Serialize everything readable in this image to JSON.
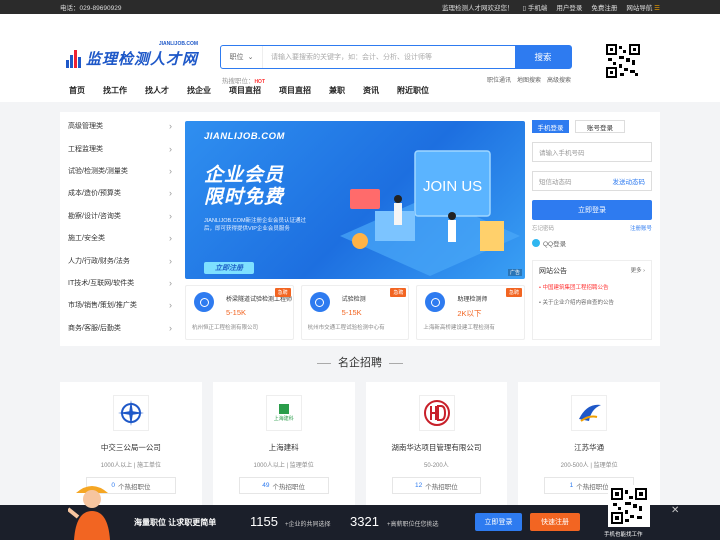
{
  "topbar": {
    "phone": "电话：029-89690929",
    "welcome": "监理检测人才网欢迎您！",
    "mobile": "手机端",
    "user_login": "用户登录",
    "free_register": "免费注册",
    "site_nav": "网站导航"
  },
  "logo": {
    "text": "监理检测人才网",
    "domain": "JIANLIJOB.COM"
  },
  "search": {
    "category": "职位",
    "placeholder": "请输入要搜索的关键字，如：会计、分析、设计师等",
    "button": "搜索",
    "hot_label": "热搜职位：",
    "links": [
      "职位通讯",
      "地图搜索",
      "高级搜索"
    ]
  },
  "nav": {
    "items": [
      "首页",
      "找工作",
      "找人才",
      "找企业",
      "项目直招",
      "项目直招",
      "兼职",
      "资讯",
      "附近职位"
    ],
    "hot_badge": "HOT"
  },
  "categories": [
    "高级管理类",
    "工程监理类",
    "试验/检测类/测量类",
    "成本/造价/预算类",
    "勘察/设计/咨询类",
    "施工/安全类",
    "人力/行政/财务/法务",
    "IT技术/互联网/软件类",
    "市场/销售/策划/推广类",
    "商务/客服/后勤类"
  ],
  "banner": {
    "site": "JIANLIJOB.COM",
    "headline1": "企业会员",
    "headline2": "限时免费",
    "desc": "JIANLIJOB.COM新注册企业会员认证通过后，即可获得提供VIP企业会员服务",
    "register": "立即注册",
    "ad": "广告",
    "sign": "JOIN US"
  },
  "jobs": [
    {
      "title": "桥梁隧道试验检测工程师",
      "salary": "5-15K",
      "company": "杭州恒正工程检测有限公司",
      "tag": "急聘"
    },
    {
      "title": "试验检测",
      "salary": "5-15K",
      "company": "杭州市交通工程试验检测中心有",
      "tag": "急聘"
    },
    {
      "title": "助理检测师",
      "salary": "2K以下",
      "company": "上海新高桥建设建工程检测有",
      "tag": "急聘"
    }
  ],
  "login": {
    "tab_phone": "手机登录",
    "tab_account": "账号登录",
    "phone_placeholder": "请输入手机号码",
    "sms_placeholder": "短信动态码",
    "send_sms": "发送动态码",
    "submit": "立即登录",
    "forgot": "忘记密码",
    "register": "注册账号",
    "qq": "QQ登录"
  },
  "notice": {
    "title": "网站公告",
    "more": "更多",
    "items": [
      "中国建筑集团工程招聘公告",
      "关于企业介绍内容自查的公告"
    ]
  },
  "section": {
    "title": "名企招聘"
  },
  "companies": [
    {
      "name": "中交三公局一公司",
      "meta": "1000人以上 | 施工单位",
      "count": "0",
      "pos_label": "个热招职位"
    },
    {
      "name": "上海建科",
      "meta": "1000人以上 | 监理单位",
      "count": "49",
      "pos_label": "个热招职位",
      "logo_text": "上海建科"
    },
    {
      "name": "湖南华达项目管理有限公司",
      "meta": "50-200人",
      "count": "12",
      "pos_label": "个热招职位"
    },
    {
      "name": "江苏华通",
      "meta": "200-500人 | 监理单位",
      "count": "1",
      "pos_label": "个热招职位"
    }
  ],
  "bottom": {
    "slogan": "海量职位 让求职更简单",
    "num1": "1155",
    "num1_text": "+企业的共同选择",
    "num2": "3321",
    "num2_text": "+高薪职位任您挑选",
    "login": "立即登录",
    "register": "快速注册",
    "qr_text": "手机也能找工作",
    "close": "✕"
  },
  "colors": {
    "primary": "#2e7bf0",
    "accent": "#f26522",
    "topbar": "#2b2b2b"
  }
}
